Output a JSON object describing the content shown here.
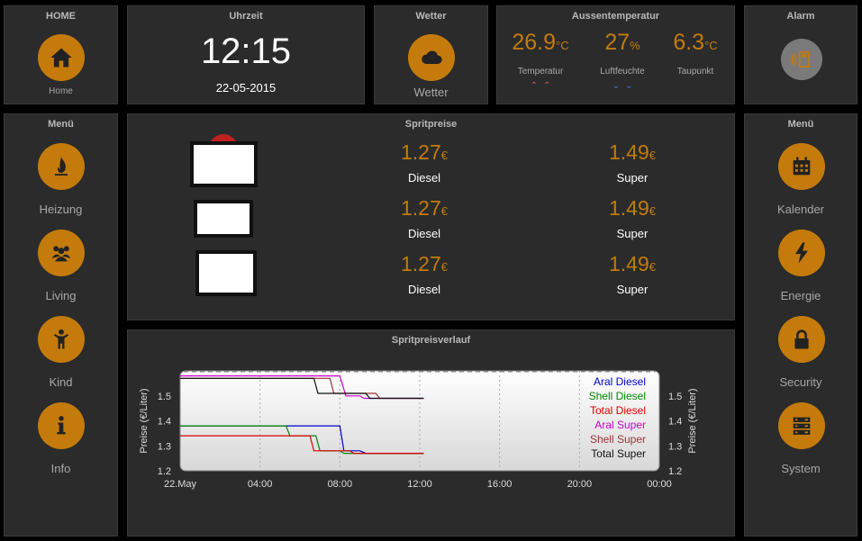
{
  "home": {
    "title": "HOME",
    "label": "Home"
  },
  "clock": {
    "title": "Uhrzeit",
    "time": "12:15",
    "date": "22-05-2015"
  },
  "weather": {
    "title": "Wetter",
    "label": "Wetter"
  },
  "outdoor": {
    "title": "Aussentemperatur",
    "temperature": {
      "value": "26.9",
      "unit": "°C",
      "label": "Temperatur"
    },
    "humidity": {
      "value": "27",
      "unit": "%",
      "label": "Luftfeuchte"
    },
    "dewpoint": {
      "value": "6.3",
      "unit": "°C",
      "label": "Taupunkt"
    },
    "trend_up_color": "#e05050",
    "trend_down_color": "#5070e0"
  },
  "alarm": {
    "title": "Alarm"
  },
  "left_menu": {
    "title": "Menü",
    "items": [
      {
        "label": "Heizung"
      },
      {
        "label": "Living"
      },
      {
        "label": "Kind"
      },
      {
        "label": "Info"
      }
    ]
  },
  "right_menu": {
    "title": "Menü",
    "items": [
      {
        "label": "Kalender"
      },
      {
        "label": "Energie"
      },
      {
        "label": "Security"
      },
      {
        "label": "System"
      }
    ]
  },
  "fuel": {
    "title": "Spritpreise",
    "stations": [
      {
        "diesel": "1.27",
        "diesel_label": "Diesel",
        "super": "1.49",
        "super_label": "Super",
        "currency": "€"
      },
      {
        "diesel": "1.27",
        "diesel_label": "Diesel",
        "super": "1.49",
        "super_label": "Super",
        "currency": "€"
      },
      {
        "diesel": "1.27",
        "diesel_label": "Diesel",
        "super": "1.49",
        "super_label": "Super",
        "currency": "€"
      }
    ]
  },
  "history": {
    "title": "Spritpreisverlauf"
  },
  "colors": {
    "accent": "#c47b0c",
    "panel": "#2b2b2b",
    "text_muted": "#a8a8a8"
  },
  "chart_data": {
    "type": "line",
    "title": "Spritpreisverlauf",
    "ylabel": "Preise (€/Liter)",
    "ylim": [
      1.2,
      1.6
    ],
    "yticks": [
      "1.2",
      "1.3",
      "1.4",
      "1.5"
    ],
    "xticks": [
      "22.May",
      "04:00",
      "08:00",
      "12:00",
      "16:00",
      "20:00",
      "00:00"
    ],
    "xlim": [
      0,
      24
    ],
    "series": [
      {
        "name": "Aral Diesel",
        "color": "#0000cc",
        "points": [
          [
            0,
            1.38
          ],
          [
            8,
            1.38
          ],
          [
            8.2,
            1.28
          ],
          [
            9,
            1.28
          ],
          [
            9.3,
            1.27
          ],
          [
            12.2,
            1.27
          ]
        ]
      },
      {
        "name": "Shell Diesel",
        "color": "#008800",
        "points": [
          [
            0,
            1.38
          ],
          [
            5.3,
            1.38
          ],
          [
            5.5,
            1.34
          ],
          [
            6.8,
            1.34
          ],
          [
            7,
            1.28
          ],
          [
            8,
            1.28
          ],
          [
            8.2,
            1.27
          ],
          [
            12.2,
            1.27
          ]
        ]
      },
      {
        "name": "Total Diesel",
        "color": "#dd0000",
        "points": [
          [
            0,
            1.34
          ],
          [
            6.5,
            1.34
          ],
          [
            6.7,
            1.28
          ],
          [
            8.5,
            1.28
          ],
          [
            8.7,
            1.27
          ],
          [
            12.2,
            1.27
          ]
        ]
      },
      {
        "name": "Aral Super",
        "color": "#cc00cc",
        "points": [
          [
            0,
            1.58
          ],
          [
            8,
            1.58
          ],
          [
            8.3,
            1.5
          ],
          [
            9,
            1.5
          ],
          [
            9.2,
            1.49
          ],
          [
            12.2,
            1.49
          ]
        ]
      },
      {
        "name": "Shell Super",
        "color": "#993333",
        "points": [
          [
            0,
            1.57
          ],
          [
            7.5,
            1.57
          ],
          [
            7.7,
            1.51
          ],
          [
            9.8,
            1.51
          ],
          [
            10,
            1.49
          ],
          [
            12.2,
            1.49
          ]
        ]
      },
      {
        "name": "Total Super",
        "color": "#111111",
        "points": [
          [
            0,
            1.57
          ],
          [
            6.7,
            1.57
          ],
          [
            6.9,
            1.51
          ],
          [
            9.3,
            1.51
          ],
          [
            9.5,
            1.49
          ],
          [
            12.2,
            1.49
          ]
        ]
      }
    ]
  }
}
